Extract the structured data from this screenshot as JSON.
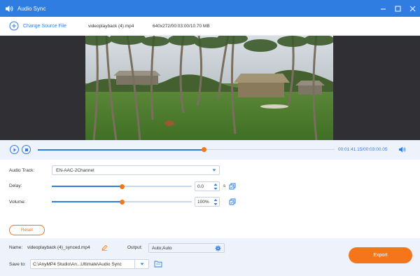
{
  "window": {
    "title": "Audio Sync",
    "accent_color": "#2f7de1",
    "icons": [
      "audio-sync-app-icon",
      "minimize-icon",
      "maximize-icon",
      "close-icon"
    ]
  },
  "file_bar": {
    "change_source_label": "Change Source File",
    "file_name": "videoplayback (4).mp4",
    "file_info": "640x272/00:03:00/10.70 MB"
  },
  "player": {
    "timecode": "00:01:41.15/00:03:00.05",
    "progress": 0.56,
    "icons": [
      "play-icon",
      "stop-icon",
      "volume-icon"
    ]
  },
  "settings": {
    "audio_track_label": "Audio Track:",
    "audio_track_value": "EN-AAC-2Channel",
    "delay_label": "Delay:",
    "delay_value": "0.0",
    "delay_unit": "s",
    "delay_slider_level": 0.5,
    "volume_label": "Volume:",
    "volume_value": "100%",
    "volume_slider_level": 0.5,
    "reset_label": "Reset"
  },
  "output": {
    "name_label": "Name:",
    "name_value": "videoplayback (4)_synced.mp4",
    "output_label": "Output:",
    "output_value": "Auto;Auto",
    "save_to_label": "Save to:",
    "save_to_value": "C:\\AnyMP4 Studio\\An...Ultimate\\Audio Sync",
    "export_label": "Export",
    "export_color": "#f5761a"
  }
}
